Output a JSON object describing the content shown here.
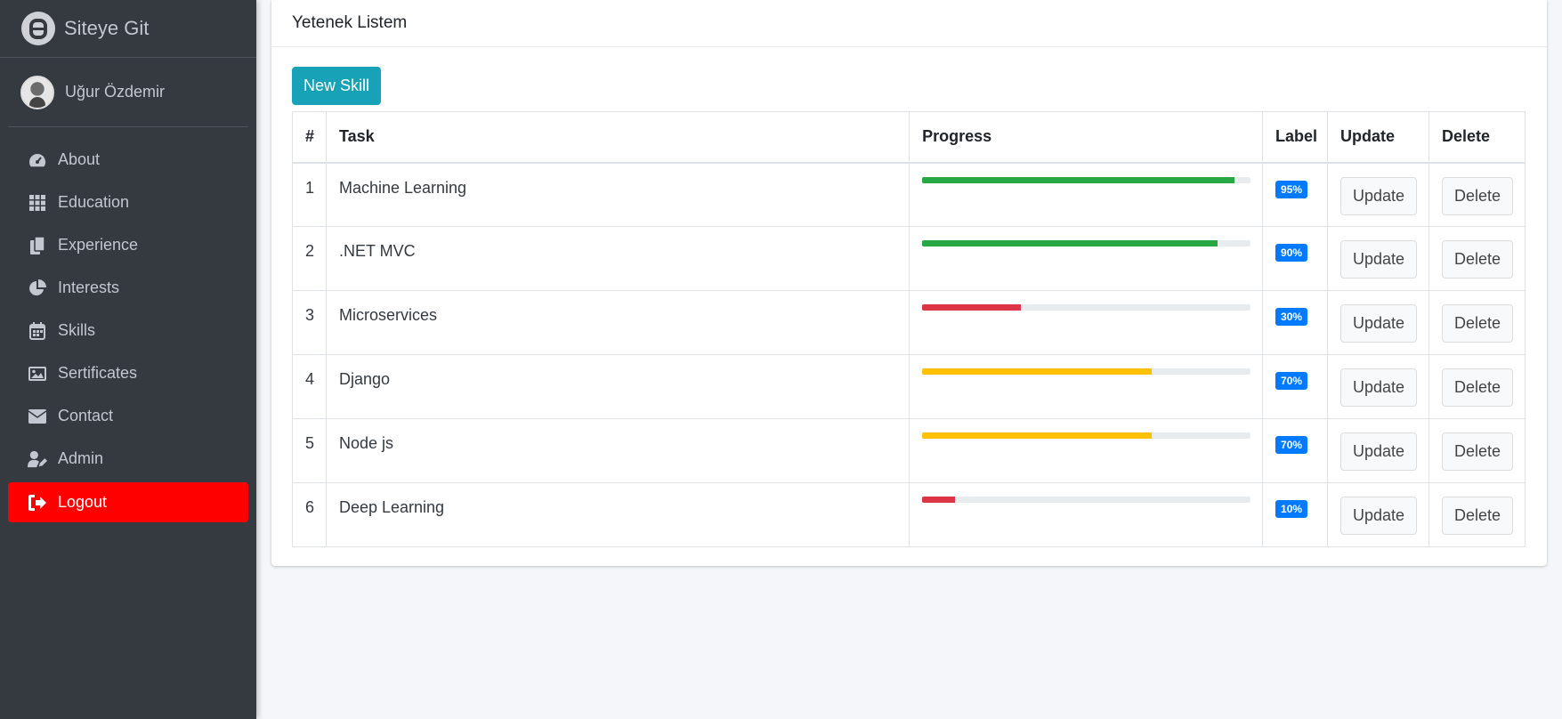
{
  "sidebar": {
    "brand": "Siteye Git",
    "user_name": "Uğur Özdemir",
    "items": [
      {
        "label": "About",
        "icon": "tachometer-icon"
      },
      {
        "label": "Education",
        "icon": "grid-icon"
      },
      {
        "label": "Experience",
        "icon": "copy-icon"
      },
      {
        "label": "Interests",
        "icon": "pie-chart-icon"
      },
      {
        "label": "Skills",
        "icon": "calendar-icon"
      },
      {
        "label": "Sertificates",
        "icon": "image-icon"
      },
      {
        "label": "Contact",
        "icon": "envelope-icon"
      },
      {
        "label": "Admin",
        "icon": "user-edit-icon"
      },
      {
        "label": "Logout",
        "icon": "sign-out-icon"
      }
    ]
  },
  "card": {
    "title": "Yetenek Listem",
    "new_button": "New Skill"
  },
  "table": {
    "headers": {
      "num": "#",
      "task": "Task",
      "progress": "Progress",
      "label": "Label",
      "update": "Update",
      "delete": "Delete"
    },
    "rows": [
      {
        "num": "1",
        "task": "Machine Learning",
        "progress": 95,
        "label": "95%",
        "color": "#28a745",
        "update": "Update",
        "delete": "Delete"
      },
      {
        "num": "2",
        "task": ".NET MVC",
        "progress": 90,
        "label": "90%",
        "color": "#28a745",
        "update": "Update",
        "delete": "Delete"
      },
      {
        "num": "3",
        "task": "Microservices",
        "progress": 30,
        "label": "30%",
        "color": "#dc3545",
        "update": "Update",
        "delete": "Delete"
      },
      {
        "num": "4",
        "task": "Django",
        "progress": 70,
        "label": "70%",
        "color": "#ffc107",
        "update": "Update",
        "delete": "Delete"
      },
      {
        "num": "5",
        "task": "Node js",
        "progress": 70,
        "label": "70%",
        "color": "#ffc107",
        "update": "Update",
        "delete": "Delete"
      },
      {
        "num": "6",
        "task": "Deep Learning",
        "progress": 10,
        "label": "10%",
        "color": "#dc3545",
        "update": "Update",
        "delete": "Delete"
      }
    ]
  }
}
